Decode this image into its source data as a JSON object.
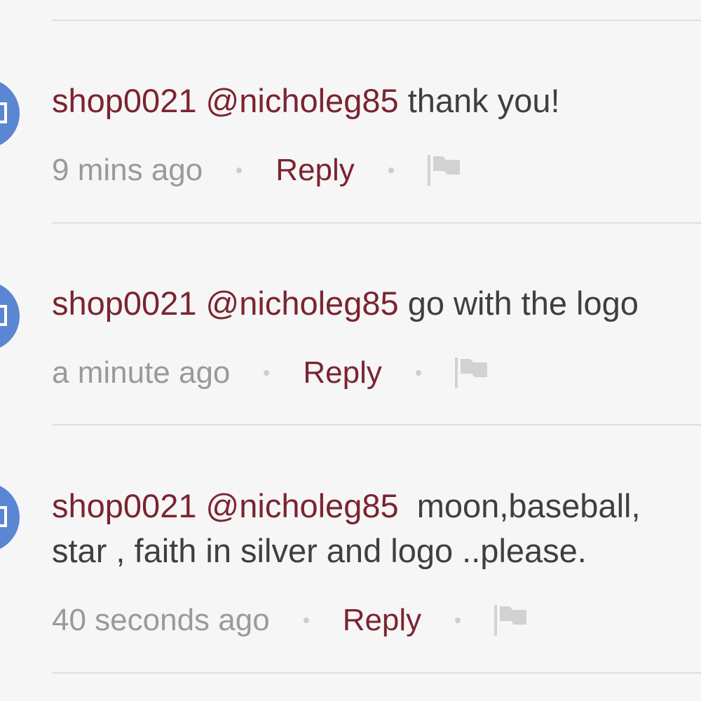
{
  "comments": [
    {
      "username": "shop0021",
      "mention": "@nicholeg85",
      "text": "thank you!",
      "time": "9 mins ago",
      "reply_label": "Reply"
    },
    {
      "username": "shop0021",
      "mention": "@nicholeg85",
      "text": "go with the logo",
      "time": "a minute ago",
      "reply_label": "Reply"
    },
    {
      "username": "shop0021",
      "mention": "@nicholeg85",
      "text_line1": "moon,baseball,",
      "text_line2": "star , faith in silver and logo ..please.",
      "time": "40 seconds ago",
      "reply_label": "Reply"
    }
  ],
  "icons": {
    "avatar": "user-avatar-icon",
    "flag": "flag-icon"
  },
  "colors": {
    "accent": "#7b2430",
    "avatar": "#5a86d3",
    "text": "#3f3f3f",
    "muted": "#9a9a9a",
    "divider": "#dedede",
    "background": "#f6f6f6"
  }
}
